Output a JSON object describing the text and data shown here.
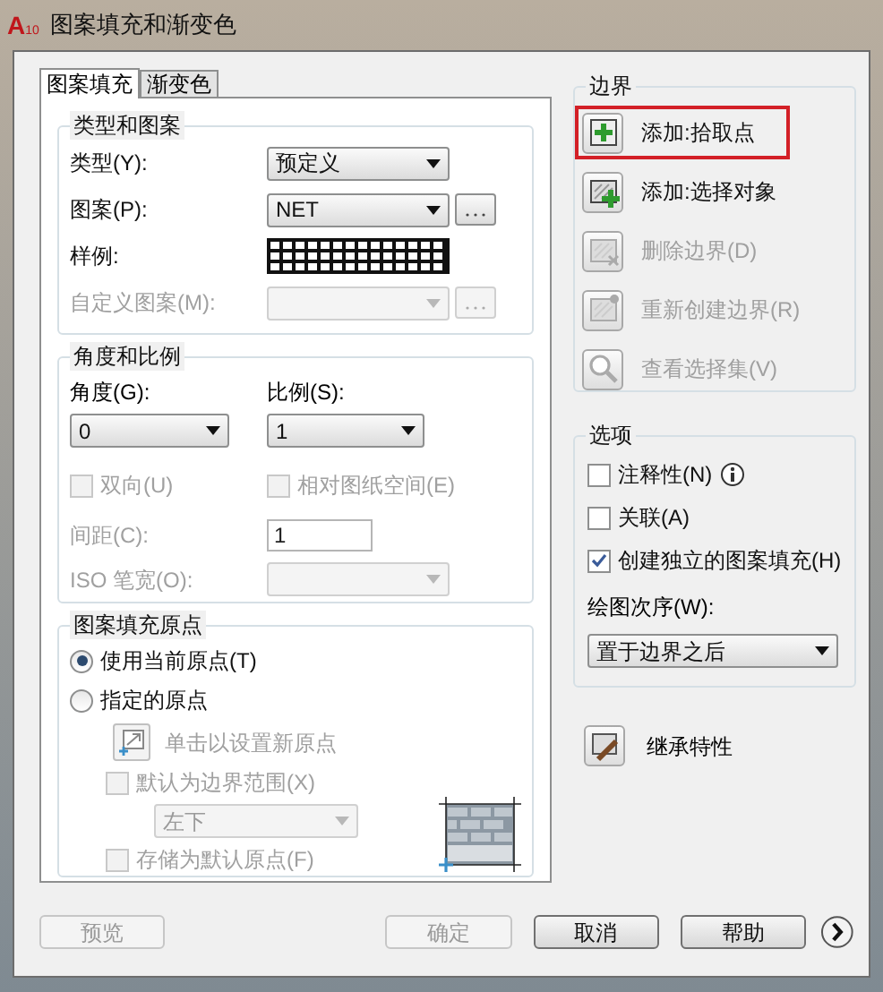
{
  "window": {
    "title": "图案填充和渐变色",
    "badge": {
      "letter": "A",
      "number": "10"
    }
  },
  "tabs": [
    {
      "label": "图案填充",
      "selected": true
    },
    {
      "label": "渐变色",
      "selected": false
    }
  ],
  "type_and_pattern": {
    "title": "类型和图案",
    "rows": [
      {
        "kind": "combo",
        "label": "类型(Y):",
        "value": "预定义",
        "disabled": false,
        "browse": false
      },
      {
        "kind": "combo",
        "label": "图案(P):",
        "value": "NET",
        "disabled": false,
        "browse": true
      },
      {
        "kind": "swatch",
        "label": "样例:",
        "disabled": false
      },
      {
        "kind": "combo",
        "label": "自定义图案(M):",
        "disabled": true,
        "browse": true
      }
    ]
  },
  "angle_and_scale": {
    "title": "角度和比例",
    "angle": {
      "label": "角度(G):",
      "value": "0"
    },
    "scale": {
      "label": "比例(S):",
      "value": "1"
    },
    "checkboxes": [
      {
        "label": "双向(U)",
        "checked": false,
        "disabled": true
      },
      {
        "label": "相对图纸空间(E)",
        "checked": false,
        "disabled": true
      }
    ],
    "spacing": {
      "label": "间距(C):",
      "value": "1",
      "disabled": true
    },
    "iso_pen": {
      "label": "ISO 笔宽(O):",
      "disabled": true
    }
  },
  "origin": {
    "title": "图案填充原点",
    "radios": [
      {
        "label": "使用当前原点(T)",
        "selected": true
      },
      {
        "label": "指定的原点",
        "selected": false
      }
    ],
    "set_origin": {
      "label": "单击以设置新原点",
      "disabled": true
    },
    "default_extent": {
      "label": "默认为边界范围(X)",
      "checked": false,
      "disabled": true
    },
    "position": {
      "value": "左下",
      "disabled": true
    },
    "store_default": {
      "label": "存储为默认原点(F)",
      "checked": false,
      "disabled": true
    }
  },
  "boundaries": {
    "title": "边界",
    "actions": [
      {
        "kind": "pick",
        "label": "添加:拾取点",
        "disabled": false,
        "highlighted": true
      },
      {
        "kind": "select",
        "label": "添加:选择对象",
        "disabled": false,
        "highlighted": false
      },
      {
        "kind": "remove",
        "label": "删除边界(D)",
        "disabled": true,
        "highlighted": false
      },
      {
        "kind": "recreate",
        "label": "重新创建边界(R)",
        "disabled": true,
        "highlighted": false
      },
      {
        "kind": "view",
        "label": "查看选择集(V)",
        "disabled": true,
        "highlighted": false
      }
    ]
  },
  "options": {
    "title": "选项",
    "checkboxes": [
      {
        "label": "注释性(N)",
        "checked": false,
        "info": true
      },
      {
        "label": "关联(A)",
        "checked": false,
        "info": false
      },
      {
        "label": "创建独立的图案填充(H)",
        "checked": true,
        "info": false
      }
    ],
    "draw_order": {
      "label": "绘图次序(W):",
      "value": "置于边界之后"
    }
  },
  "inherit": {
    "label": "继承特性"
  },
  "buttons": [
    {
      "label": "预览",
      "disabled": true
    },
    {
      "label": "确定",
      "disabled": true
    },
    {
      "label": "取消",
      "disabled": false
    },
    {
      "label": "帮助",
      "disabled": false
    }
  ]
}
